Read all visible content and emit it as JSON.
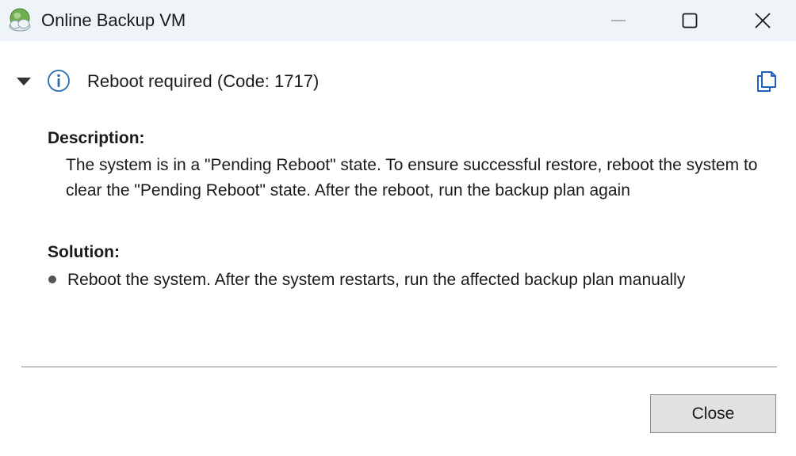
{
  "window": {
    "title": "Online Backup VM",
    "app_icon": "cloud-globe-icon",
    "controls": {
      "minimize": "minimize-icon",
      "maximize": "maximize-icon",
      "close": "close-icon"
    }
  },
  "message": {
    "expanded": true,
    "status_icon": "info-icon",
    "title": "Reboot required (Code: 1717)",
    "copy_icon": "copy-icon"
  },
  "description": {
    "label": "Description:",
    "text": "The system is in a \"Pending Reboot\" state. To ensure successful restore, reboot the system to clear the \"Pending Reboot\" state. After the reboot, run the backup plan again"
  },
  "solution": {
    "label": "Solution:",
    "items": [
      "Reboot the system. After the system restarts, run the affected backup plan manually"
    ]
  },
  "footer": {
    "close_label": "Close"
  },
  "colors": {
    "titlebar_bg": "#eff4f9",
    "info_accent": "#2b6cb0",
    "copy_accent": "#1f5fbf",
    "button_bg": "#e1e1e1"
  }
}
